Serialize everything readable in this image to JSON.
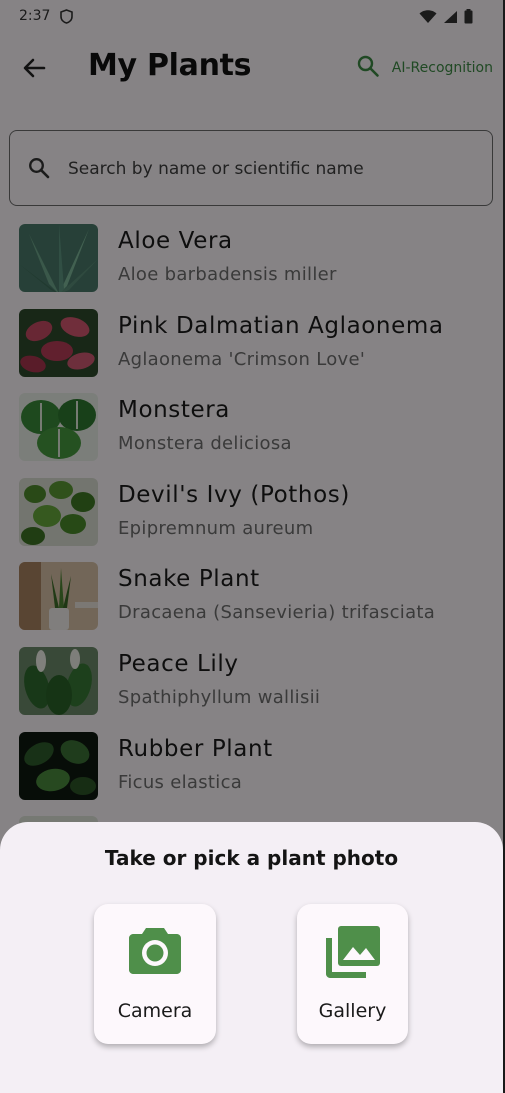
{
  "status_bar": {
    "time": "2:37",
    "icons": [
      "shield-icon",
      "wifi-icon",
      "signal-icon",
      "battery-icon"
    ]
  },
  "app_bar": {
    "title": "My Plants",
    "ai_button_label": "AI-Recognition",
    "icons": [
      "back-arrow-icon",
      "search-icon"
    ]
  },
  "search": {
    "placeholder": "Search by name or scientific name",
    "value": ""
  },
  "plants": [
    {
      "name": "Aloe Vera",
      "scientific": "Aloe barbadensis miller"
    },
    {
      "name": "Pink Dalmatian Aglaonema",
      "scientific": "Aglaonema 'Crimson Love'"
    },
    {
      "name": "Monstera",
      "scientific": "Monstera deliciosa"
    },
    {
      "name": "Devil's Ivy (Pothos)",
      "scientific": "Epipremnum aureum"
    },
    {
      "name": "Snake Plant",
      "scientific": "Dracaena (Sansevieria) trifasciata"
    },
    {
      "name": "Peace Lily",
      "scientific": "Spathiphyllum wallisii"
    },
    {
      "name": "Rubber Plant",
      "scientific": "Ficus elastica"
    },
    {
      "name": "",
      "scientific": ""
    }
  ],
  "sheet": {
    "title": "Take or pick a plant photo",
    "camera_label": "Camera",
    "gallery_label": "Gallery",
    "icons": [
      "camera-icon",
      "gallery-icon"
    ]
  },
  "colors": {
    "accent": "#3d8b44",
    "icon_green": "#4f8f4a",
    "scrim": "rgba(0,0,0,0.47)",
    "sheet_bg": "#f4eff5"
  }
}
